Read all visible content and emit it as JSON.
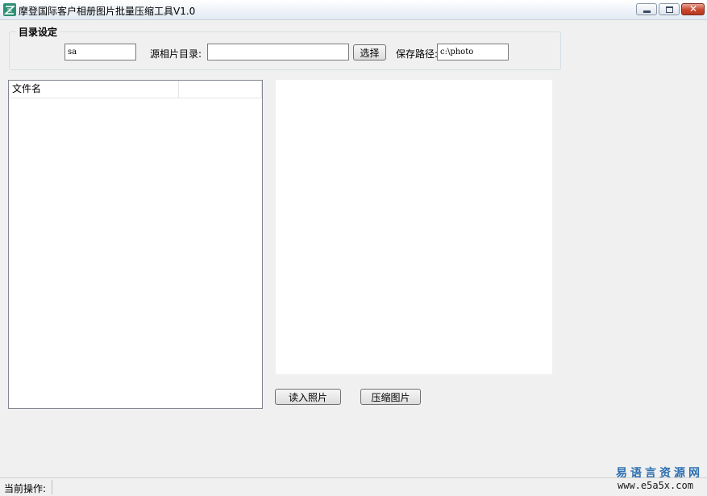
{
  "window": {
    "title": "摩登国际客户相册图片批量压缩工具V1.0",
    "close_glyph": "✕"
  },
  "directory_group": {
    "legend": "目录设定",
    "first_input_value": "sa",
    "source_label": "源相片目录:",
    "source_value": "",
    "choose_button": "选择",
    "save_label": "保存路径:",
    "save_value": "c:\\photo"
  },
  "file_list": {
    "columns": [
      "文件名",
      ""
    ]
  },
  "buttons": {
    "read": "读入照片",
    "compress": "压缩图片"
  },
  "status": {
    "label": "当前操作:"
  },
  "watermark": {
    "chinese": "易语言资源网",
    "url": "www.e5a5x.com"
  }
}
